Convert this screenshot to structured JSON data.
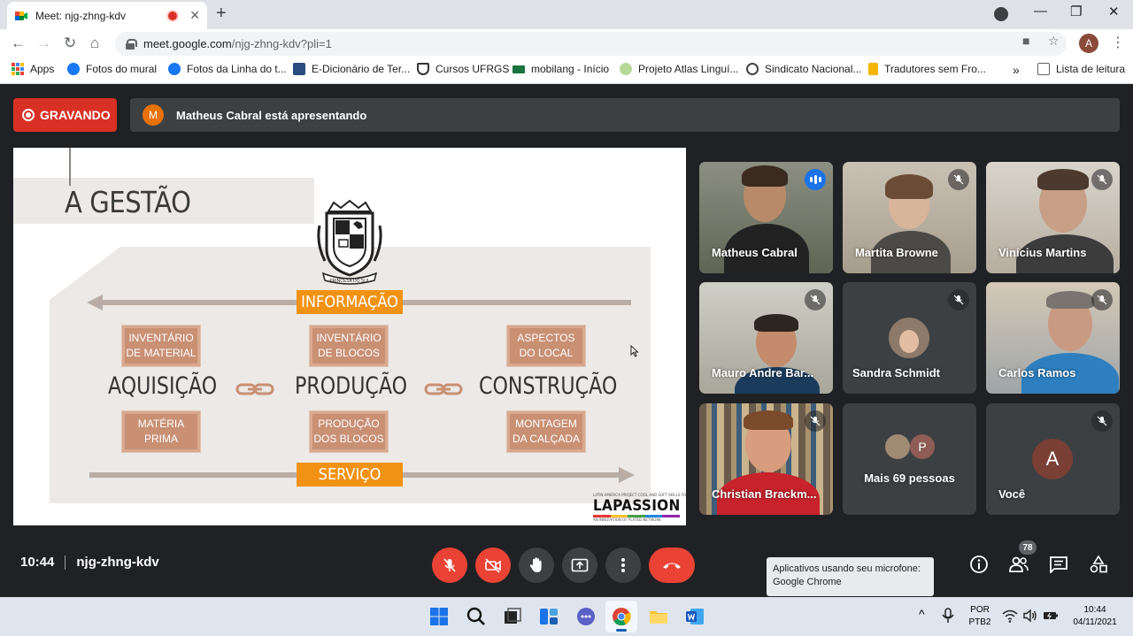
{
  "browser": {
    "tab_title": "Meet: njg-zhng-kdv",
    "url_domain": "meet.google.com",
    "url_path": "/njg-zhng-kdv?pli=1",
    "profile_initial": "A",
    "bookmarks": [
      {
        "label": "Apps"
      },
      {
        "label": "Fotos do mural"
      },
      {
        "label": "Fotos da Linha do t..."
      },
      {
        "label": "E-Dicionário de Ter..."
      },
      {
        "label": "Cursos UFRGS"
      },
      {
        "label": "mobilang - Início"
      },
      {
        "label": "Projeto Atlas Linguí..."
      },
      {
        "label": "Sindicato Nacional..."
      },
      {
        "label": "Tradutores sem Fro..."
      }
    ],
    "reading_list": "Lista de leitura",
    "more_bookmarks": "»"
  },
  "meet": {
    "recording_label": "GRAVANDO",
    "presenter_initial": "M",
    "presenting_text": "Matheus Cabral está apresentando",
    "clock": "10:44",
    "meeting_code": "njg-zhng-kdv",
    "participant_count": "78",
    "tooltip_line1": "Aplicativos usando seu microfone:",
    "tooltip_line2": "Google Chrome"
  },
  "slide": {
    "title": "A GESTÃO",
    "top_arrow_label": "INFORMAÇÃO",
    "bottom_arrow_label": "SERVIÇO",
    "stages": [
      "AQUISIÇÃO",
      "PRODUÇÃO",
      "CONSTRUÇÃO"
    ],
    "top_boxes": [
      {
        "line1": "INVENTÁRIO",
        "line2": "DE MATERIAL"
      },
      {
        "line1": "INVENTÁRIO",
        "line2": "DE BLOCOS"
      },
      {
        "line1": "ASPECTOS",
        "line2": "DO LOCAL"
      }
    ],
    "bottom_boxes": [
      {
        "line1": "MATÉRIA",
        "line2": "PRIMA"
      },
      {
        "line1": "PRODUÇÃO",
        "line2": "DOS BLOCOS"
      },
      {
        "line1": "MONTAGEM",
        "line2": "DA CALÇADA"
      }
    ],
    "crest_motto": "PRINCESA DO SUL",
    "logo_small": "LATIN AMERICA PROJECT COOL AND SOFT SKILLS FOR",
    "logo_name": "LAPASSION",
    "logo_sub": "AN INNOVATION OF PLATED NETWORK"
  },
  "participants": [
    {
      "name": "Matheus Cabral",
      "speaking": true
    },
    {
      "name": "Martita Browne",
      "muted": true
    },
    {
      "name": "Vinicius Martins",
      "muted": true
    },
    {
      "name": "Mauro Andre Bar...",
      "muted": true
    },
    {
      "name": "Sandra Schmidt",
      "muted": true
    },
    {
      "name": "Carlos Ramos",
      "muted": true
    },
    {
      "name": "Christian Brackm...",
      "muted": true
    },
    {
      "name": "Mais 69 pessoas",
      "avatar_initial": "P"
    },
    {
      "name": "Você",
      "avatar_initial": "A",
      "muted": true
    }
  ],
  "taskbar": {
    "lang1": "POR",
    "lang2": "PTB2",
    "time": "10:44",
    "date": "04/11/2021"
  },
  "colors": {
    "record_red": "#d93025",
    "meet_bg": "#202124",
    "tile_bg": "#3c4043",
    "slide_orange": "#f29214",
    "slide_brown": "#c99074",
    "speaking_blue": "#8ab4f8"
  }
}
